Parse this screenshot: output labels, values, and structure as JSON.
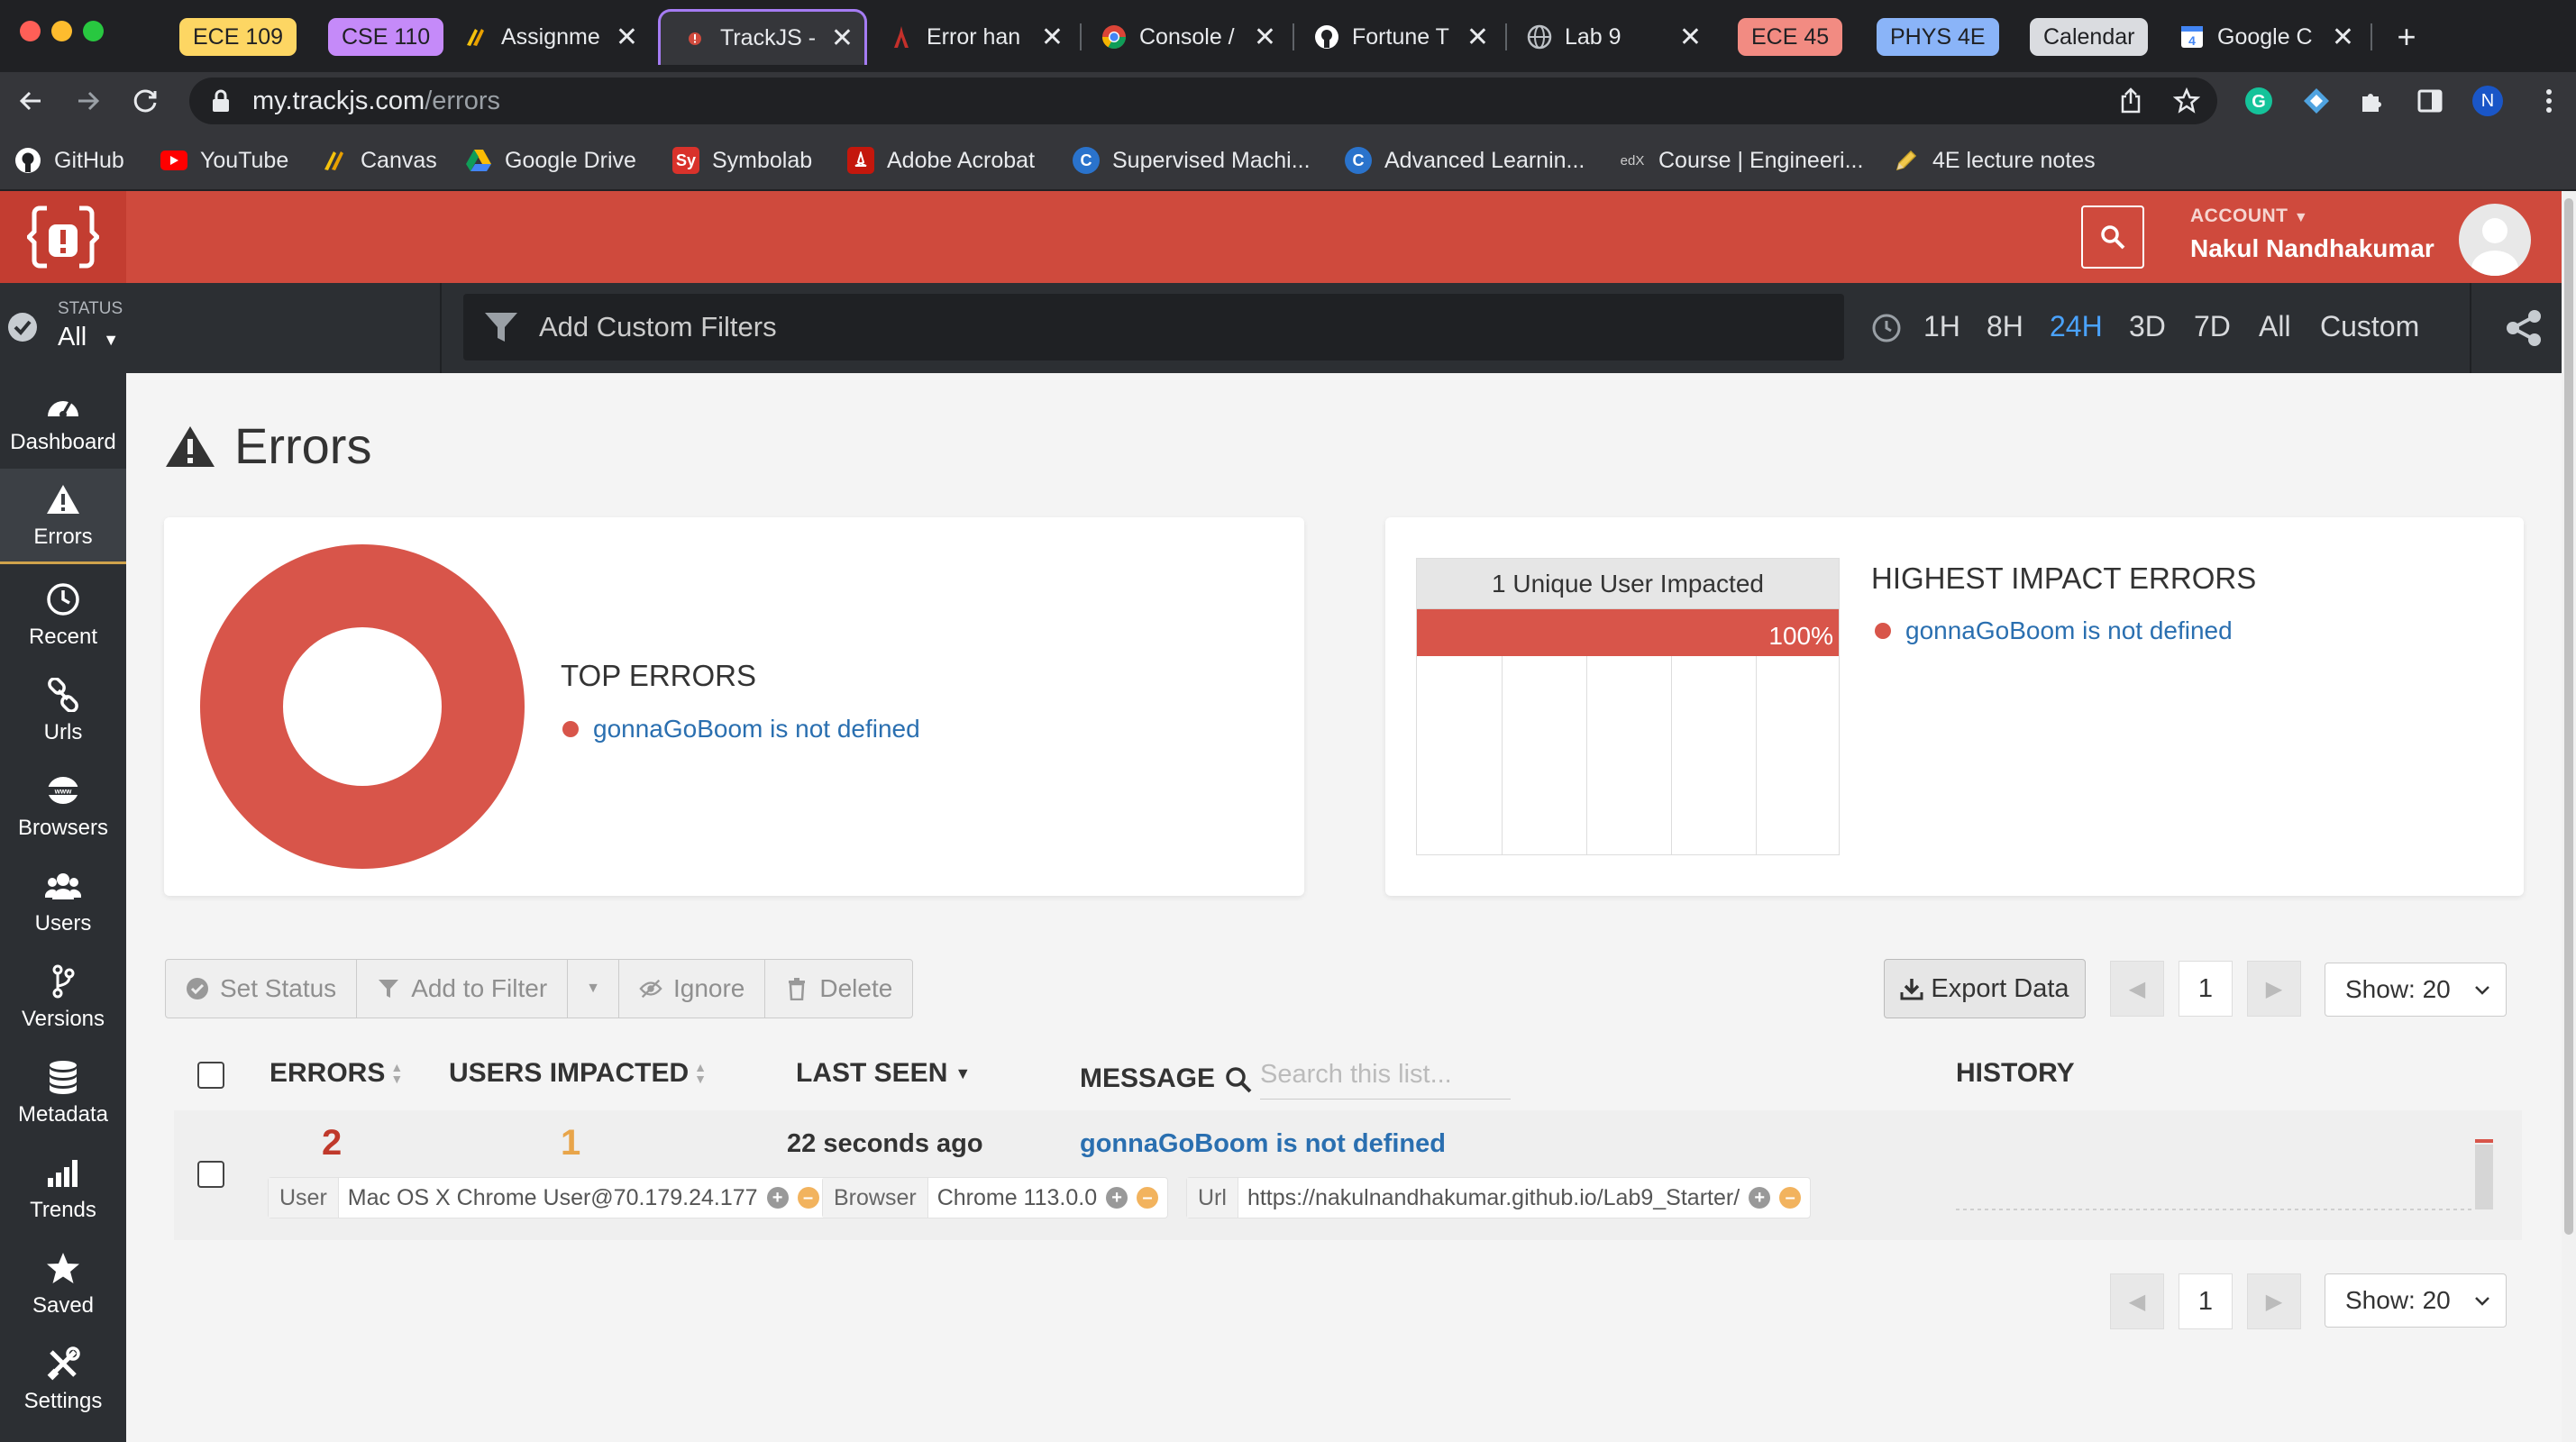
{
  "browser": {
    "tabs": [
      {
        "type": "group",
        "label": "ECE 109",
        "color": "#fdd663"
      },
      {
        "type": "group",
        "label": "CSE 110",
        "color": "#c58af9"
      },
      {
        "type": "tab",
        "title": "Assignme",
        "icon": "canvas-icon",
        "close": "✕"
      },
      {
        "type": "tab",
        "title": "TrackJS -",
        "icon": "trackjs-icon",
        "close": "✕",
        "active": true
      },
      {
        "type": "tab",
        "title": "Error han",
        "icon": "mdn-icon",
        "close": "✕"
      },
      {
        "type": "tab",
        "title": "Console /",
        "icon": "chrome-icon",
        "close": "✕"
      },
      {
        "type": "tab",
        "title": "Fortune T",
        "icon": "github-icon",
        "close": "✕"
      },
      {
        "type": "tab",
        "title": "Lab 9",
        "icon": "globe-icon",
        "close": "✕"
      },
      {
        "type": "group",
        "label": "ECE 45",
        "color": "#f28b82"
      },
      {
        "type": "group",
        "label": "PHYS 4E",
        "color": "#8ab4f8"
      },
      {
        "type": "group",
        "label": "Calendar",
        "color": "#dadce0"
      },
      {
        "type": "tab",
        "title": "Google C",
        "icon": "google-calendar-icon",
        "close": "✕"
      }
    ],
    "new_tab": "+",
    "url_host": "my.trackjs.com",
    "url_path": "/errors",
    "profile_initial": "N",
    "bookmarks": [
      "GitHub",
      "YouTube",
      "Canvas",
      "Google Drive",
      "Symbolab",
      "Adobe Acrobat",
      "Supervised Machi...",
      "Advanced Learnin...",
      "Course | Engineeri...",
      "4E lecture notes"
    ]
  },
  "header": {
    "account_label": "ACCOUNT",
    "account_name": "Nakul Nandhakumar"
  },
  "filters": {
    "status_label": "STATUS",
    "status_value": "All",
    "custom_filter_placeholder": "Add Custom Filters",
    "ranges": [
      "1H",
      "8H",
      "24H",
      "3D",
      "7D",
      "All",
      "Custom"
    ],
    "selected_range": "24H"
  },
  "nav": [
    "Dashboard",
    "Errors",
    "Recent",
    "Urls",
    "Browsers",
    "Users",
    "Versions",
    "Metadata",
    "Trends",
    "Saved",
    "Settings"
  ],
  "page": {
    "title": "Errors",
    "top_errors": {
      "title": "TOP ERRORS",
      "items": [
        {
          "label": "gonnaGoBoom is not defined",
          "share": 1.0,
          "color": "#d8554a"
        }
      ]
    },
    "impact": {
      "header": "1 Unique User Impacted",
      "percent_label": "100%",
      "percent": 1.0,
      "title": "HIGHEST IMPACT ERRORS",
      "items": [
        "gonnaGoBoom is not defined"
      ]
    },
    "actions": {
      "set_status": "Set Status",
      "add_to_filter": "Add to Filter",
      "ignore": "Ignore",
      "delete": "Delete",
      "export": "Export Data"
    },
    "pagination": {
      "page": "1",
      "show": "Show: 20"
    },
    "table": {
      "headers": {
        "errors": "ERRORS",
        "users": "USERS IMPACTED",
        "last_seen": "LAST SEEN",
        "message": "MESSAGE",
        "history": "HISTORY"
      },
      "search_placeholder": "Search this list...",
      "rows": [
        {
          "errors": "2",
          "users": "1",
          "last_seen": "22 seconds ago",
          "message": "gonnaGoBoom is not defined",
          "tags": [
            {
              "key": "User",
              "value": "Mac OS X Chrome User@70.179.24.177"
            },
            {
              "key": "Browser",
              "value": "Chrome 113.0.0"
            },
            {
              "key": "Url",
              "value": "https://nakulnandhakumar.github.io/Lab9_Starter/"
            }
          ]
        }
      ]
    }
  }
}
